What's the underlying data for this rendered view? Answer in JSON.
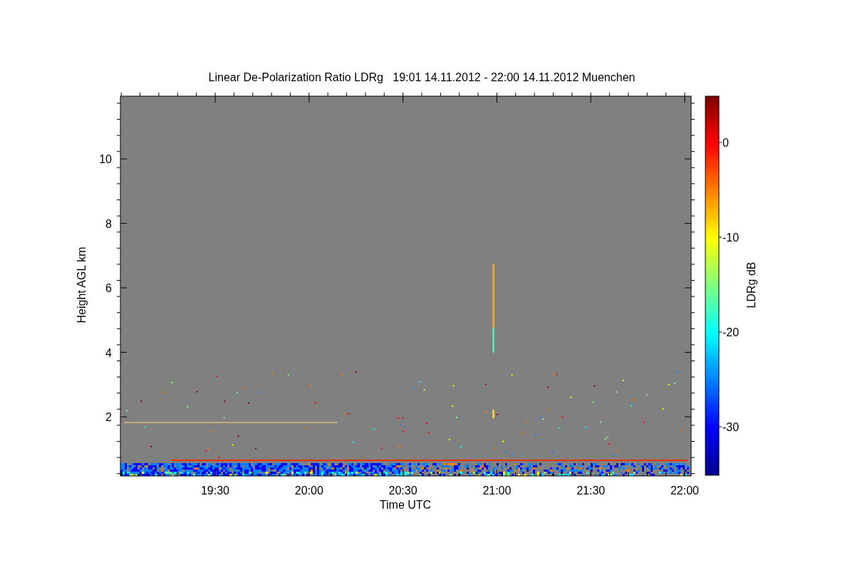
{
  "title": "Linear De-Polarization Ratio LDRg   19:01 14.11.2012 - 22:00 14.11.2012 Muenchen",
  "plot": {
    "xlabel": "Time UTC",
    "ylabel": "Height AGL km",
    "xticks": [
      "19:30",
      "20:00",
      "20:30",
      "21:00",
      "21:30",
      "22:00"
    ],
    "yticks": [
      "10",
      "8",
      "6",
      "4",
      "2"
    ]
  },
  "colorbar": {
    "label": "LDRg dB",
    "ticks": [
      "0",
      "-10",
      "-20",
      "-30"
    ]
  }
}
